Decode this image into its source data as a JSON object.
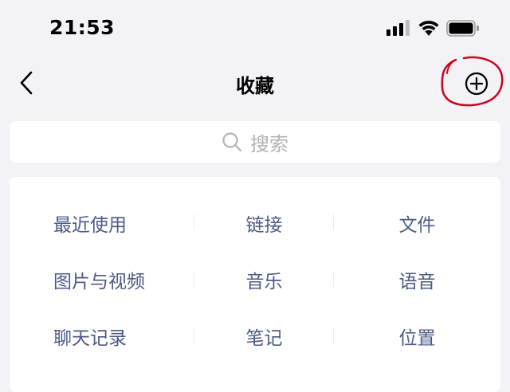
{
  "status_bar": {
    "time": "21:53",
    "icons": [
      "cellular-signal-icon",
      "wifi-icon",
      "battery-icon"
    ]
  },
  "nav": {
    "title": "收藏",
    "back_icon": "chevron-left-icon",
    "add_icon": "plus-circle-icon"
  },
  "search": {
    "placeholder": "搜索",
    "icon": "search-icon"
  },
  "categories": [
    {
      "label": "最近使用"
    },
    {
      "label": "链接"
    },
    {
      "label": "文件"
    },
    {
      "label": "图片与视频"
    },
    {
      "label": "音乐"
    },
    {
      "label": "语音"
    },
    {
      "label": "聊天记录"
    },
    {
      "label": "笔记"
    },
    {
      "label": "位置"
    }
  ],
  "colors": {
    "background": "#f2f2f7",
    "card": "#ffffff",
    "category_text": "#4c5a86",
    "placeholder_text": "#b3b3b8",
    "annotation": "#d0021b"
  }
}
